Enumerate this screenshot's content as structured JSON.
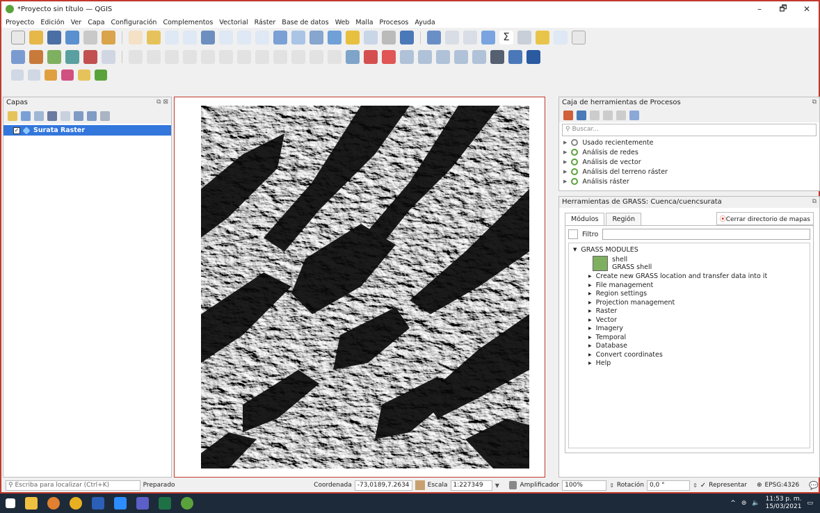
{
  "window": {
    "title": "*Proyecto sin título — QGIS",
    "minimize": "–",
    "maximize": "🗗",
    "close": "✕"
  },
  "menu": [
    "Proyecto",
    "Edición",
    "Ver",
    "Capa",
    "Configuración",
    "Complementos",
    "Vectorial",
    "Ráster",
    "Base de datos",
    "Web",
    "Malla",
    "Procesos",
    "Ayuda"
  ],
  "layers_panel": {
    "title": "Capas",
    "layer_name": "Surata Raster",
    "layer_checked": "✓"
  },
  "toolbox_panel": {
    "title": "Caja de herramientas de Procesos",
    "search_placeholder": "Buscar...",
    "items": [
      "Usado recientemente",
      "Análisis de redes",
      "Análisis de vector",
      "Análisis del terreno ráster",
      "Análisis ráster"
    ]
  },
  "grass_panel": {
    "title": "Herramientas de GRASS: Cuenca/cuencsurata",
    "tab_modules": "Módulos",
    "tab_region": "Región",
    "close_mapset": "Cerrar directorio de mapas",
    "filter_label": "Filtro",
    "root": "GRASS MODULES",
    "shell_title": "shell",
    "shell_subtitle": "GRASS shell",
    "modules": [
      "Create new GRASS location and transfer data into it",
      "File management",
      "Region settings",
      "Projection management",
      "Raster",
      "Vector",
      "Imagery",
      "Temporal",
      "Database",
      "Convert coordinates",
      "Help"
    ]
  },
  "status": {
    "locator_placeholder": "Escriba para localizar (Ctrl+K)",
    "state": "Preparado",
    "coord_label": "Coordenada",
    "coord_value": "-73,0189,7.2634",
    "scale_label": "Escala",
    "scale_value": "1:227349",
    "magnifier_label": "Amplificador",
    "magnifier_value": "100%",
    "rotation_label": "Rotación",
    "rotation_value": "0,0 °",
    "render_label": "Representar",
    "crs": "EPSG:4326"
  },
  "taskbar": {
    "time": "11:53 p. m.",
    "date": "15/03/2021"
  },
  "colors": {
    "accent_border": "#c0392b",
    "selection": "#3377dd",
    "qgis_green": "#5aa33c",
    "taskbar": "#1d2a3a"
  }
}
